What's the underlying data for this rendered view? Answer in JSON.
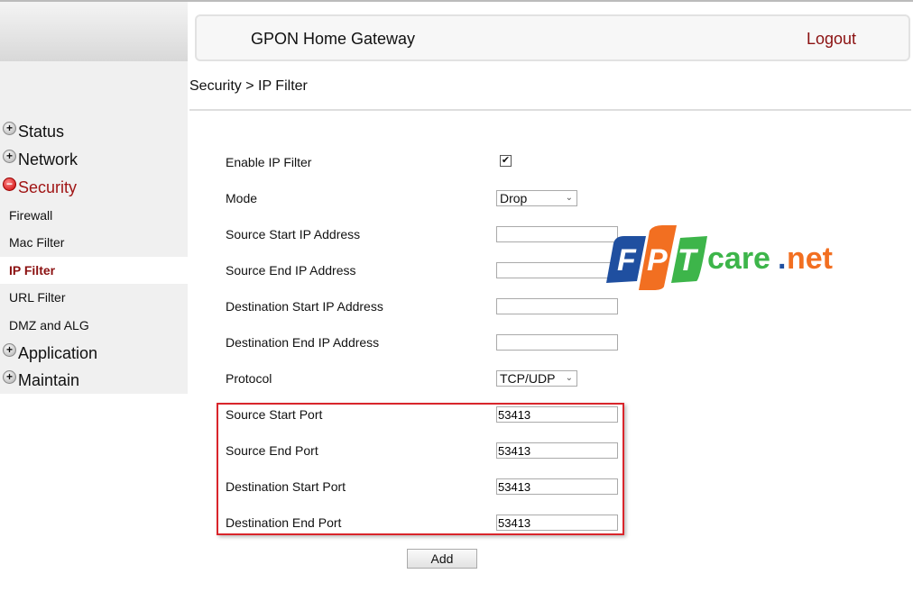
{
  "header": {
    "title": "GPON Home Gateway",
    "logout": "Logout"
  },
  "breadcrumb": "Security > IP Filter",
  "sidebar": {
    "menus": [
      {
        "label": "Status"
      },
      {
        "label": "Network"
      },
      {
        "label": "Security"
      },
      {
        "label": "Application"
      },
      {
        "label": "Maintain"
      }
    ],
    "security_items": [
      {
        "label": "Firewall"
      },
      {
        "label": "Mac Filter"
      },
      {
        "label": "IP Filter"
      },
      {
        "label": "URL Filter"
      },
      {
        "label": "DMZ and ALG"
      }
    ]
  },
  "form": {
    "enable_label": "Enable IP Filter",
    "enable_checked": true,
    "mode_label": "Mode",
    "mode_value": "Drop",
    "src_start_ip_label": "Source Start IP Address",
    "src_start_ip": "",
    "src_end_ip_label": "Source End IP Address",
    "src_end_ip": "",
    "dst_start_ip_label": "Destination Start IP Address",
    "dst_start_ip": "",
    "dst_end_ip_label": "Destination End IP Address",
    "dst_end_ip": "",
    "protocol_label": "Protocol",
    "protocol_value": "TCP/UDP",
    "src_start_port_label": "Source Start Port",
    "src_start_port": "53413",
    "src_end_port_label": "Source End Port",
    "src_end_port": "53413",
    "dst_start_port_label": "Destination Start Port",
    "dst_start_port": "53413",
    "dst_end_port_label": "Destination End Port",
    "dst_end_port": "53413",
    "add_label": "Add"
  },
  "watermark": {
    "text": "FPTcare.net",
    "colors": {
      "F": "#1f4fa0",
      "P": "#f26f21",
      "T": "#3db54a",
      "care": "#3db54a",
      "net": "#f26f21"
    }
  },
  "colors": {
    "accent": "#8b1111",
    "highlight_box": "#d9252b"
  }
}
